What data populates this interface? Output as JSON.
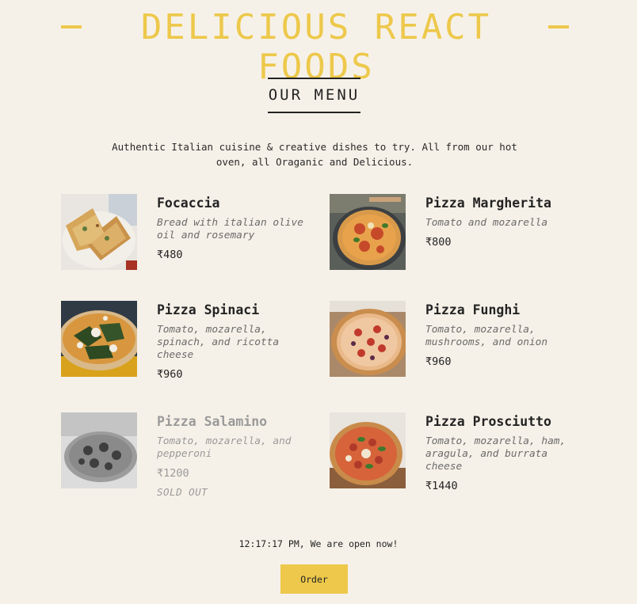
{
  "header": {
    "title": "DELICIOUS REACT FOODS"
  },
  "menu": {
    "title": "OUR MENU",
    "intro": "Authentic Italian cuisine & creative dishes to try. All from our hot oven, all Oraganic and Delicious."
  },
  "pizzas": [
    {
      "name": "Focaccia",
      "ingredients": "Bread with italian olive oil and rosemary",
      "price": "₹480",
      "sold_out": false
    },
    {
      "name": "Pizza Margherita",
      "ingredients": "Tomato and mozarella",
      "price": "₹800",
      "sold_out": false
    },
    {
      "name": "Pizza Spinaci",
      "ingredients": "Tomato, mozarella, spinach, and ricotta cheese",
      "price": "₹960",
      "sold_out": false
    },
    {
      "name": "Pizza Funghi",
      "ingredients": "Tomato, mozarella, mushrooms, and onion",
      "price": "₹960",
      "sold_out": false
    },
    {
      "name": "Pizza Salamino",
      "ingredients": "Tomato, mozarella, and pepperoni",
      "price": "₹1200",
      "sold_out": true,
      "sold_label": "SOLD OUT"
    },
    {
      "name": "Pizza Prosciutto",
      "ingredients": "Tomato, mozarella, ham, aragula, and burrata cheese",
      "price": "₹1440",
      "sold_out": false
    }
  ],
  "footer": {
    "status": "12:17:17 PM, We are open now!",
    "order_label": "Order"
  },
  "colors": {
    "accent": "#edc84b",
    "background": "#f6f1e8",
    "text": "#232323"
  }
}
